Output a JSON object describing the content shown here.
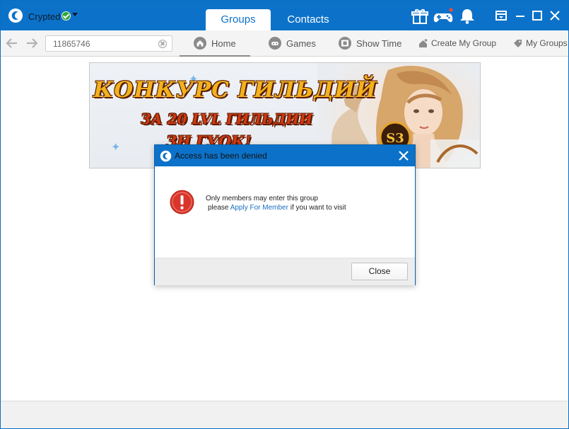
{
  "titlebar": {
    "username": "Crypted",
    "status_icon": "online-check-icon",
    "tabs": [
      {
        "label": "Groups",
        "active": true
      },
      {
        "label": "Contacts",
        "active": false
      }
    ],
    "icons": [
      "gift-icon",
      "gamepad-icon",
      "bell-icon"
    ],
    "window_controls": [
      "skin-icon",
      "minimize-icon",
      "maximize-icon",
      "close-icon"
    ]
  },
  "navbar": {
    "address_value": "11865746",
    "tabs": [
      {
        "label": "Home",
        "icon": "home-icon",
        "active": true
      },
      {
        "label": "Games",
        "icon": "gamepad-icon",
        "active": false
      },
      {
        "label": "Show Time",
        "icon": "film-icon",
        "active": false
      },
      {
        "label": "Create My Group",
        "icon": "create-group-icon",
        "active": false
      },
      {
        "label": "My Groups",
        "icon": "tag-icon",
        "active": false
      }
    ]
  },
  "banner": {
    "line1": "КОНКУРС ГИЛЬДИЙ",
    "line2": "ЗА 20 LVL ГИЛЬДИИ",
    "line3": "ЗН ГУОК!"
  },
  "dialog": {
    "title": "Access has been denied",
    "message_line1": "Only members may enter this group",
    "message_prefix": "please ",
    "message_link": "Apply For Member",
    "message_suffix": " if you want to visit",
    "close_label": "Close"
  },
  "colors": {
    "brand_blue": "#0c72c9",
    "error_red": "#d9352a",
    "link_blue": "#1a6fc4"
  }
}
